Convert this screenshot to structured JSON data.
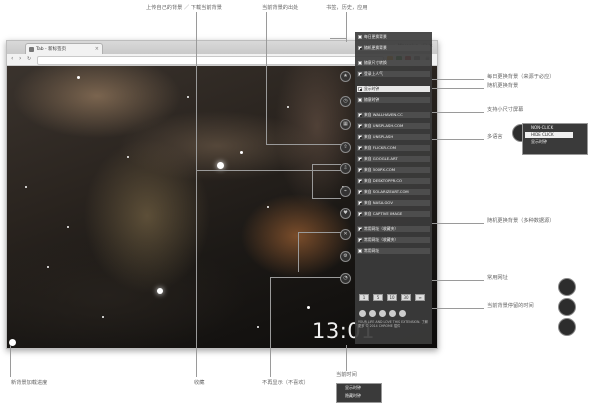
{
  "browser": {
    "tab_title": "Tab - 新标签页",
    "account_label": "Marcelus",
    "window_buttons": "– ▢ ✕",
    "nav_back": "‹",
    "nav_forward": "›",
    "nav_reload": "↻",
    "nav_menu": "≡"
  },
  "clock": "13:01",
  "annotations": {
    "upload_download": "上传自己的背景 ／ 下载当前背景",
    "current_source": "当前背景的出处",
    "bookmark_history_apps": "书签，历史，应用",
    "daily_background": "每日更换背景（来源于必应）",
    "random_wallpaper": "随机更换背景",
    "mini_window": "支持小尺寸屏幕",
    "multi_language": "多语言",
    "random_sources": "随机更换背景（多种数据源）",
    "common_urls": "常用网址",
    "current_bg_duration": "当前背景停留的时间",
    "new_bg_progress": "新背景加载进度",
    "favorite": "收藏",
    "not_show_again": "不再显示（不喜欢）",
    "current_time": "当前时间"
  },
  "panel": {
    "rows": [
      {
        "label": "每日更换背景",
        "checked": false,
        "light": false
      },
      {
        "label": "随机更换背景",
        "checked": true,
        "light": false
      },
      {
        "label": "",
        "checked": false,
        "light": false
      },
      {
        "label": "随意尺寸转换",
        "checked": false,
        "light": false
      },
      {
        "label": "登录上人气",
        "checked": true,
        "light": false
      },
      {
        "label": "",
        "checked": false,
        "light": false
      },
      {
        "label": "显示时钟",
        "checked": true,
        "light": true
      },
      {
        "label": "随意时钟",
        "checked": false,
        "light": false
      },
      {
        "label": "",
        "checked": false,
        "light": false
      },
      {
        "label": "来自 WALLHAVEN.CC",
        "checked": true,
        "light": false
      },
      {
        "label": "来自 UNSPLASH.COM",
        "checked": true,
        "light": false
      },
      {
        "label": "来自 UNSPLASH",
        "checked": true,
        "light": false
      },
      {
        "label": "来自 FLICKR.COM",
        "checked": true,
        "light": false
      },
      {
        "label": "来自 GOOGLE.ART",
        "checked": true,
        "light": false
      },
      {
        "label": "来自 500PX.COM",
        "checked": true,
        "light": false
      },
      {
        "label": "来自 DESKTOPPR.CO",
        "checked": true,
        "light": false
      },
      {
        "label": "来自 SOLARIZEART.COM",
        "checked": true,
        "light": false
      },
      {
        "label": "来自 NASA.GOV",
        "checked": true,
        "light": false
      },
      {
        "label": "来自 CAPTIVE IMAGE",
        "checked": true,
        "light": false
      },
      {
        "label": "",
        "checked": false,
        "light": false
      },
      {
        "label": "常用网址（收藏夹）",
        "checked": true,
        "light": false
      },
      {
        "label": "常用网址（收藏夹）",
        "checked": true,
        "light": false
      },
      {
        "label": "常用网址",
        "checked": false,
        "light": false
      }
    ],
    "duration_buttons": [
      "1",
      "5",
      "10",
      "30",
      "∞"
    ],
    "footer_text": "YOUR LIFE AND LOVE THIS EXTENSION. 了解更多 © 2014 CHROME 插件"
  },
  "language_zoom": {
    "rows": [
      "NON-CLICK",
      "HIDE CLICK",
      "显示时钟"
    ],
    "highlight_row": "HIDE CLICK"
  },
  "time_zoom": {
    "rows": [
      "显示时钟",
      "隐藏时钟"
    ]
  },
  "clock_zoom": {
    "rows": [
      "显示时钟",
      "隐藏时钟"
    ]
  }
}
